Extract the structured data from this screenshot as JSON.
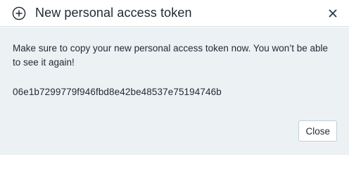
{
  "dialog": {
    "title": "New personal access token",
    "title_icon": "plus-circle-icon",
    "close_icon": "close-icon",
    "message": "Make sure to copy your new personal access token now. You won’t be able to see it again!",
    "token": "06e1b7299779f946fbd8e42be48537e75194746b",
    "close_button_label": "Close"
  },
  "colors": {
    "body_background": "#ecf1f4",
    "header_background": "#ffffff",
    "text": "#1f2933"
  }
}
